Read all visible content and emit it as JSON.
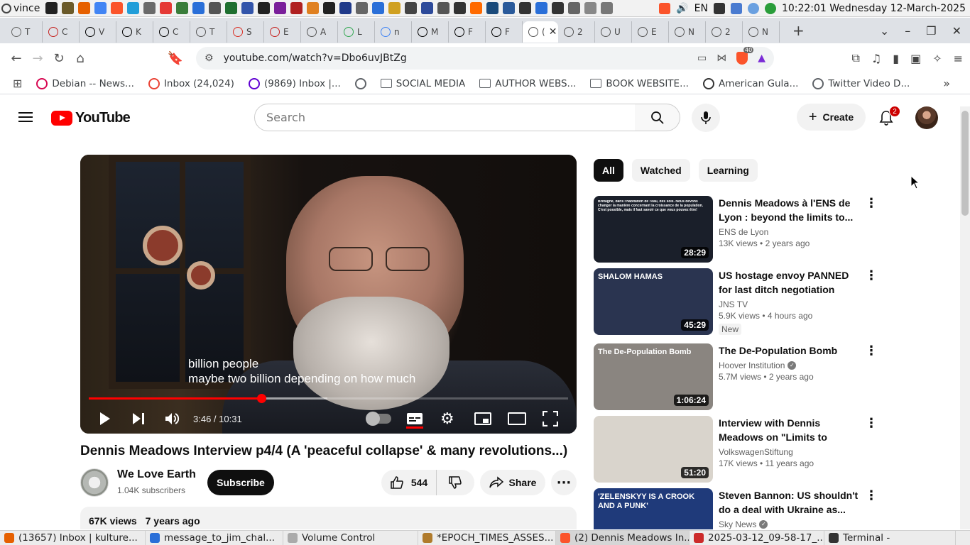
{
  "system_panel": {
    "user": "vince",
    "lang": "EN",
    "clock": "10:22:01 Wednesday 12-March-2025",
    "launcher_icons": [
      "terminal-icon",
      "folder-icon",
      "firefox-icon",
      "chrome-icon",
      "brave-icon",
      "telegram-icon",
      "network-icon",
      "mail-icon",
      "book-icon",
      "app-icon",
      "settings-icon",
      "game-icon",
      "shield-icon",
      "text-icon",
      "vivaldi-icon",
      "image-icon",
      "circle-app-icon",
      "monitor-icon",
      "usb-icon",
      "puzzle-icon",
      "note-icon",
      "doc-icon",
      "library-icon",
      "image-viewer-icon",
      "calculator-icon",
      "gamepad-icon",
      "headset-icon",
      "screen-icon",
      "steam-icon",
      "wave-icon",
      "calendar-icon",
      "flower-icon",
      "question-icon",
      "toggle-icon",
      "grid-icon"
    ]
  },
  "browser": {
    "tabs": [
      {
        "letter": "T",
        "color": "#666"
      },
      {
        "letter": "C",
        "color": "#c5221f"
      },
      {
        "letter": "V",
        "color": "#000"
      },
      {
        "letter": "K",
        "color": "#000"
      },
      {
        "letter": "C",
        "color": "#000"
      },
      {
        "letter": "T",
        "color": "#555"
      },
      {
        "letter": "S",
        "color": "#d93025"
      },
      {
        "letter": "E",
        "color": "#c5221f"
      },
      {
        "letter": "A",
        "color": "#555"
      },
      {
        "letter": "L",
        "color": "#34a853"
      },
      {
        "letter": "n",
        "color": "#4285f4"
      },
      {
        "letter": "M",
        "color": "#000"
      },
      {
        "letter": "F",
        "color": "#000"
      },
      {
        "letter": "F",
        "color": "#000"
      },
      {
        "letter": "(",
        "color": "#555",
        "active": true
      },
      {
        "letter": "2",
        "color": "#555"
      },
      {
        "letter": "U",
        "color": "#555"
      },
      {
        "letter": "E",
        "color": "#555"
      },
      {
        "letter": "N",
        "color": "#555"
      },
      {
        "letter": "2",
        "color": "#555"
      },
      {
        "letter": "N",
        "color": "#555"
      }
    ],
    "new_tab": "+",
    "url": "youtube.com/watch?v=Dbo6uvJBtZg",
    "shield_count": "40"
  },
  "bookmarks": [
    {
      "label": "Debian -- News...",
      "icon": "debian-icon",
      "color": "#d70751"
    },
    {
      "label": "Inbox (24,024)",
      "icon": "gmail-icon",
      "color": "#ea4335"
    },
    {
      "label": "(9869) Inbox |...",
      "icon": "yahoo-mail-icon",
      "color": "#6001d2"
    },
    {
      "label": "",
      "icon": "globe-icon",
      "color": "#5f6368"
    },
    {
      "label": "SOCIAL MEDIA",
      "icon": "folder-icon",
      "color": ""
    },
    {
      "label": "AUTHOR WEBS...",
      "icon": "folder-icon",
      "color": ""
    },
    {
      "label": "BOOK WEBSITE...",
      "icon": "folder-icon",
      "color": ""
    },
    {
      "label": "American Gula...",
      "icon": "plane-icon",
      "color": "#333"
    },
    {
      "label": "Twitter Video D...",
      "icon": "globe-icon",
      "color": "#5f6368"
    }
  ],
  "youtube": {
    "logo_text": "YouTube",
    "search_placeholder": "Search",
    "create_label": "Create",
    "notification_count": "2",
    "player": {
      "subtitle_line1": "billion people",
      "subtitle_line2": "maybe two billion depending on how much",
      "time": "3:46 / 10:31",
      "progress": 0.36,
      "buffered": 0.498
    },
    "video_title": "Dennis Meadows Interview p4/4 (A 'peaceful collapse' & many revolutions...)",
    "channel_name": "We Love Earth",
    "subscribers": "1.04K subscribers",
    "subscribe_label": "Subscribe",
    "likes": "544",
    "share_label": "Share",
    "views": "67K views",
    "age": "7 years ago",
    "chips": [
      "All",
      "Watched",
      "Learning"
    ],
    "recommendations": [
      {
        "title": "Dennis Meadows à l'ENS de Lyon : beyond the limits to...",
        "channel": "ENS de Lyon",
        "verified": false,
        "views": "13K views",
        "age": "2 years ago",
        "duration": "28:29",
        "badge": "",
        "thumb_caption": "Bretagne, dans l'habitation de l'eau, des sols. Nous devons changer la manière concernant la croissance de la population. C'est possible, mais il faut savoir ce que vous pouvez être!",
        "thumb_bg": "#1a1f2a"
      },
      {
        "title": "US hostage envoy PANNED for last ditch negotiation tactics |...",
        "channel": "JNS TV",
        "verified": false,
        "views": "5.9K views",
        "age": "4 hours ago",
        "duration": "45:29",
        "badge": "New",
        "thumb_caption": "SHALOM HAMAS",
        "thumb_bg": "#2a3450"
      },
      {
        "title": "The De-Population Bomb",
        "channel": "Hoover Institution",
        "verified": true,
        "views": "5.7M views",
        "age": "2 years ago",
        "duration": "1:06:24",
        "badge": "",
        "thumb_caption": "The De-Population Bomb",
        "thumb_bg": "#8a8580"
      },
      {
        "title": "Interview with Dennis Meadows on \"Limits to Growth\"",
        "channel": "VolkswagenStiftung",
        "verified": false,
        "views": "17K views",
        "age": "11 years ago",
        "duration": "51:20",
        "badge": "",
        "thumb_caption": "",
        "thumb_bg": "#d9d4cc"
      },
      {
        "title": "Steven Bannon: US shouldn't do a deal with Ukraine as...",
        "channel": "Sky News",
        "verified": true,
        "views": "",
        "age": "",
        "duration": "",
        "badge": "",
        "thumb_caption": "'ZELENSKYY IS A CROOK AND A PUNK'",
        "thumb_bg": "#1f3a7a"
      }
    ]
  },
  "taskbar": [
    {
      "label": "(13657) Inbox | kulture...",
      "icon": "firefox-icon",
      "color": "#e66000"
    },
    {
      "label": "message_to_jim_chal...",
      "icon": "document-icon",
      "color": "#2a6fd8"
    },
    {
      "label": "Volume Control",
      "icon": "volume-icon",
      "color": "#aaa"
    },
    {
      "label": "*EPOCH_TIMES_ASSES...",
      "icon": "editor-icon",
      "color": "#b07b2c"
    },
    {
      "label": "(2) Dennis Meadows In...",
      "icon": "brave-icon",
      "color": "#fb542b",
      "active": true
    },
    {
      "label": "2025-03-12_09-58-17_...",
      "icon": "vivaldi-icon",
      "color": "#cc2b2b"
    },
    {
      "label": "Terminal -",
      "icon": "terminal-icon",
      "color": "#333"
    }
  ]
}
